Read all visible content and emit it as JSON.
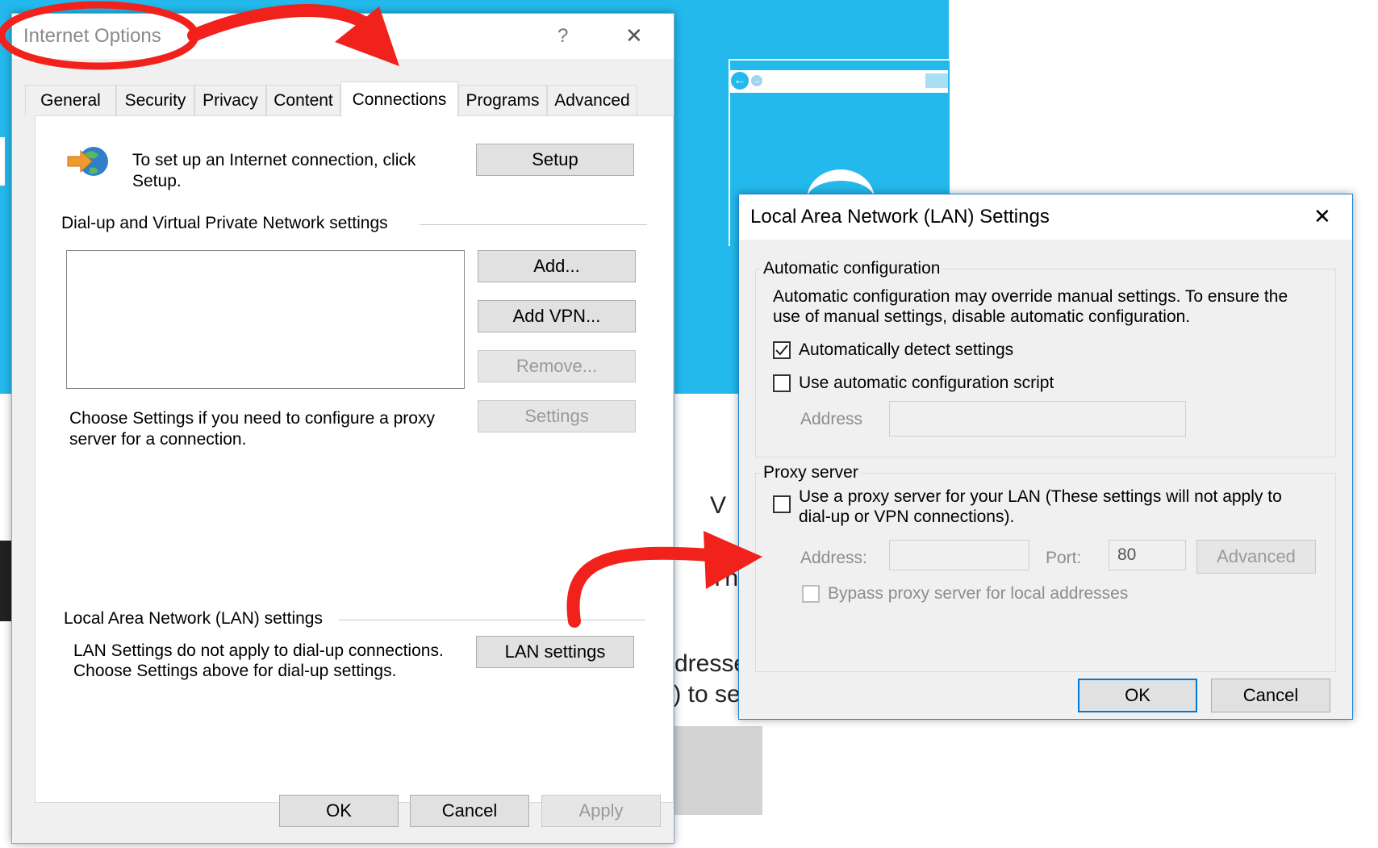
{
  "background": {
    "frag_dresse": "dresse",
    "frag_to_se": ";) to se",
    "frag_v": "V",
    "frag_th": "Th"
  },
  "internet_options": {
    "title": "Internet Options",
    "help": "?",
    "close": "✕",
    "tabs": [
      "General",
      "Security",
      "Privacy",
      "Content",
      "Connections",
      "Programs",
      "Advanced"
    ],
    "setup_text": "To set up an Internet connection, click Setup.",
    "setup_button": "Setup",
    "dialup_heading": "Dial-up and Virtual Private Network settings",
    "add_button": "Add...",
    "add_vpn_button": "Add VPN...",
    "remove_button": "Remove...",
    "settings_button": "Settings",
    "proxy_text": "Choose Settings if you need to configure a proxy server for a connection.",
    "lan_heading": "Local Area Network (LAN) settings",
    "lan_text_1": "LAN Settings do not apply to dial-up connections.",
    "lan_text_2": "Choose Settings above for dial-up settings.",
    "lan_settings_button": "LAN settings",
    "ok": "OK",
    "cancel": "Cancel",
    "apply": "Apply"
  },
  "lan_dialog": {
    "title": "Local Area Network (LAN) Settings",
    "close": "✕",
    "auto_config_heading": "Automatic configuration",
    "auto_config_text_1": "Automatic configuration may override manual settings.  To ensure the",
    "auto_config_text_2": "use of manual settings, disable automatic configuration.",
    "auto_detect_label": "Automatically detect settings",
    "auto_detect_checked": true,
    "auto_script_label": "Use automatic configuration script",
    "auto_script_checked": false,
    "address_label": "Address",
    "address_value": "",
    "proxy_heading": "Proxy server",
    "use_proxy_label_1": "Use a proxy server for your LAN (These settings will not apply to",
    "use_proxy_label_2": "dial-up or VPN connections).",
    "use_proxy_checked": false,
    "proxy_address_label": "Address:",
    "proxy_address_value": "",
    "port_label": "Port:",
    "port_value": "80",
    "advanced_button": "Advanced",
    "bypass_label": "Bypass proxy server for local addresses",
    "bypass_checked": false,
    "ok": "OK",
    "cancel": "Cancel"
  },
  "annotations": {
    "color": "#f1211c"
  }
}
